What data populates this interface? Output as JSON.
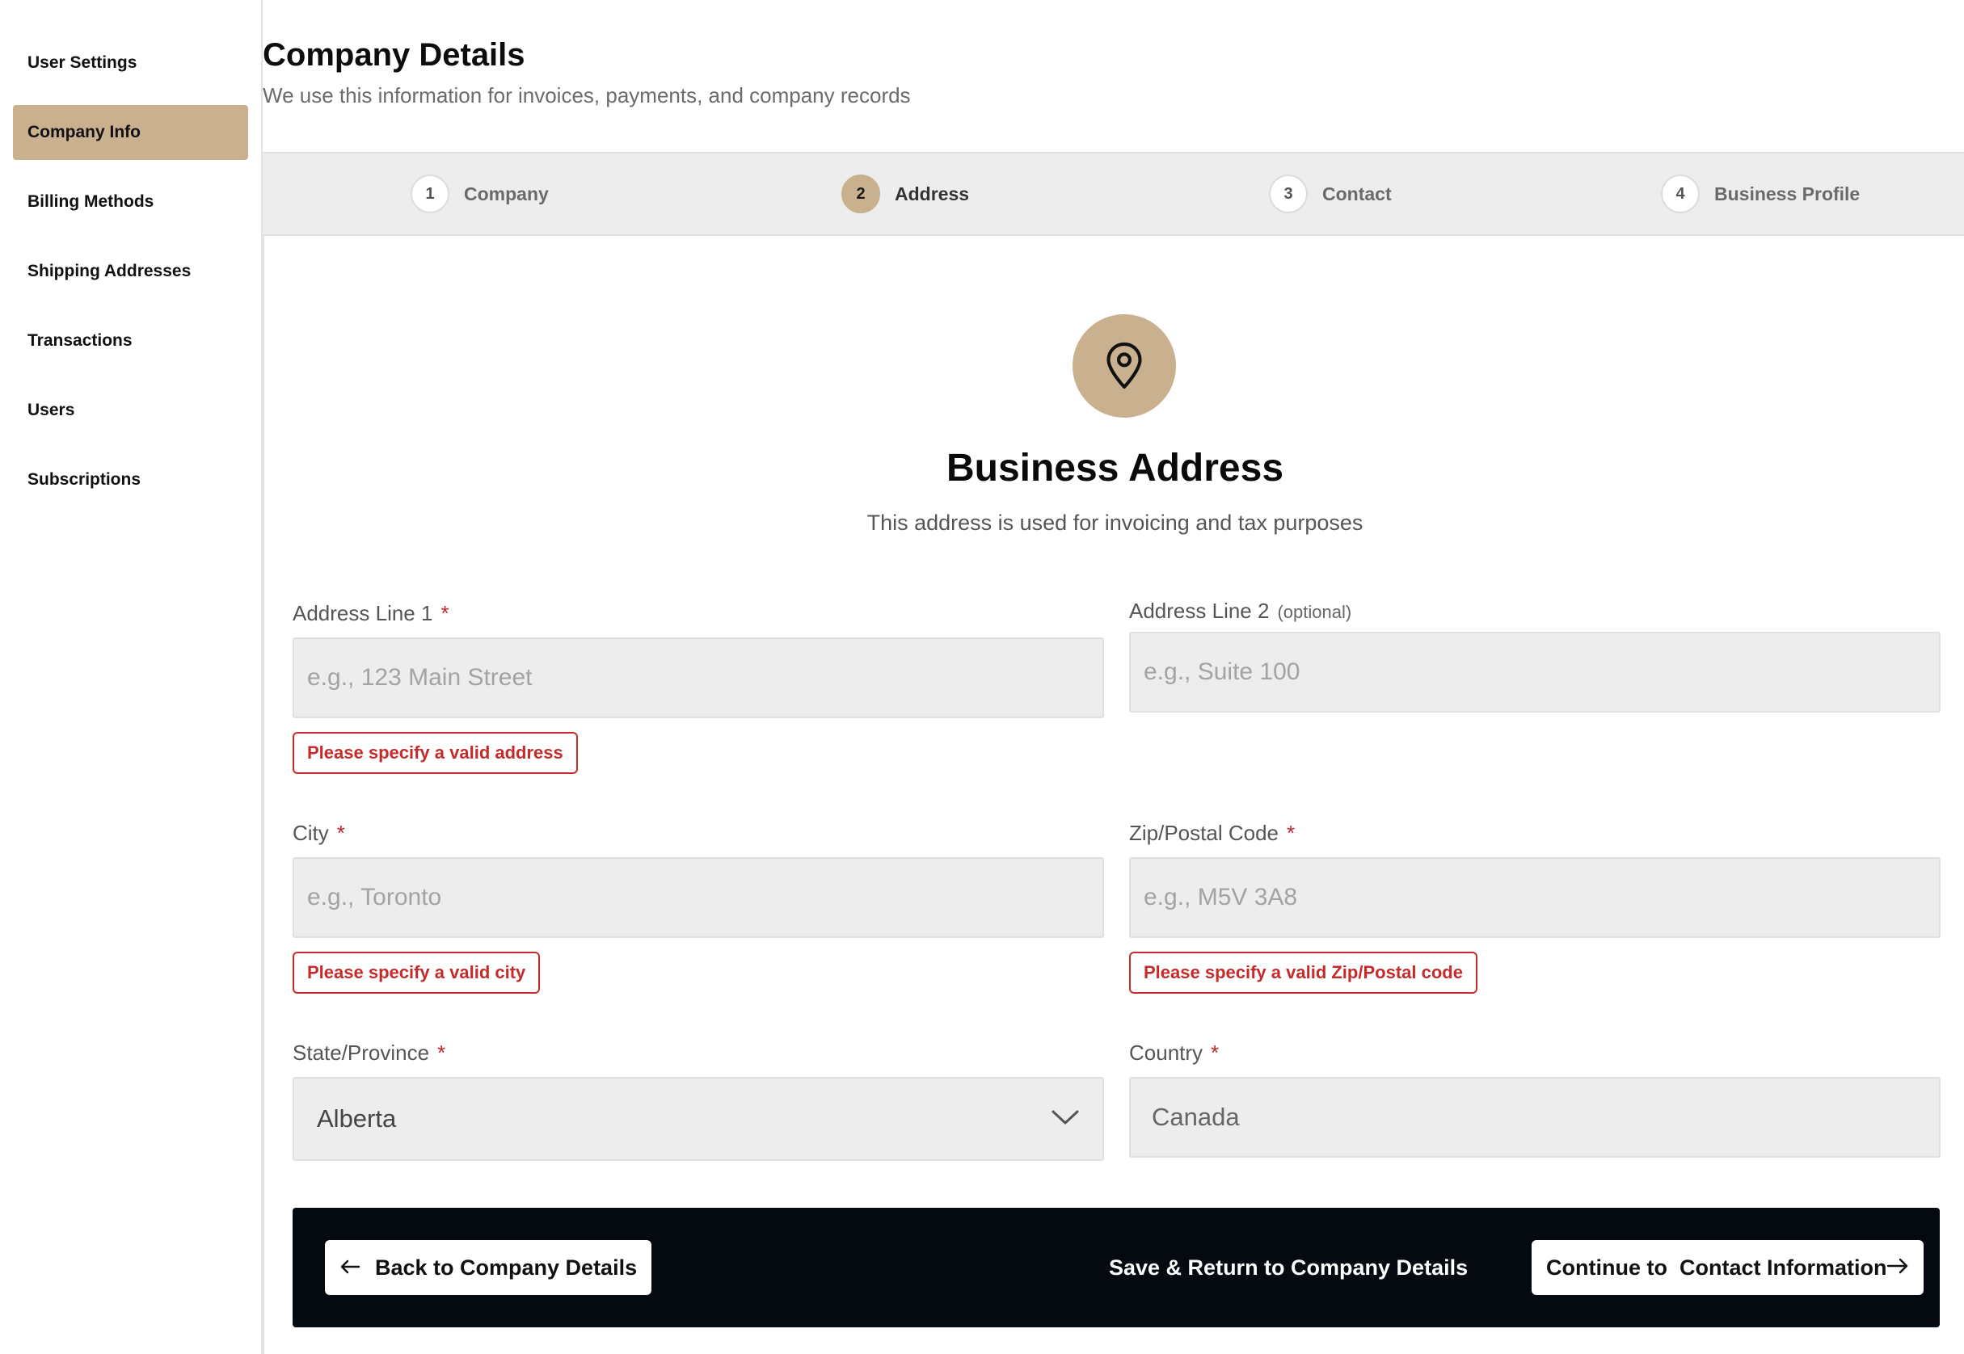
{
  "sidebar": {
    "items": [
      {
        "label": "User Settings"
      },
      {
        "label": "Company Info"
      },
      {
        "label": "Billing Methods"
      },
      {
        "label": "Shipping Addresses"
      },
      {
        "label": "Transactions"
      },
      {
        "label": "Users"
      },
      {
        "label": "Subscriptions"
      }
    ],
    "active_index": 1
  },
  "header": {
    "title": "Company Details",
    "subtitle": "We use this information for invoices, payments, and company records"
  },
  "stepper": {
    "steps": [
      {
        "number": "1",
        "label": "Company"
      },
      {
        "number": "2",
        "label": "Address"
      },
      {
        "number": "3",
        "label": "Contact"
      },
      {
        "number": "4",
        "label": "Business Profile"
      }
    ],
    "active_index": 1
  },
  "card": {
    "icon": "map-pin-icon",
    "title": "Business Address",
    "subtitle": "This address is used for invoicing and tax purposes"
  },
  "form": {
    "address1": {
      "label": "Address Line 1",
      "required_mark": "*",
      "value": "",
      "placeholder": "e.g., 123 Main Street",
      "error": "Please specify a valid address"
    },
    "address2": {
      "label": "Address Line 2",
      "optional_text": "(optional)",
      "value": "",
      "placeholder": "e.g., Suite 100"
    },
    "city": {
      "label": "City",
      "required_mark": "*",
      "value": "",
      "placeholder": "e.g., Toronto",
      "error": "Please specify a valid city"
    },
    "zip": {
      "label": "Zip/Postal Code",
      "required_mark": "*",
      "value": "",
      "placeholder": "e.g., M5V 3A8",
      "error": "Please specify a valid Zip/Postal code"
    },
    "state": {
      "label": "State/Province",
      "required_mark": "*",
      "value": "Alberta"
    },
    "country": {
      "label": "Country",
      "required_mark": "*",
      "value": "Canada"
    }
  },
  "actions": {
    "back_label": "Back to Company Details",
    "save_label": "Save & Return to Company Details",
    "continue_label": "Continue to  Contact Information"
  },
  "colors": {
    "accent": "#c9b08f",
    "error": "#c62b2b",
    "action_bar": "#050a10"
  }
}
